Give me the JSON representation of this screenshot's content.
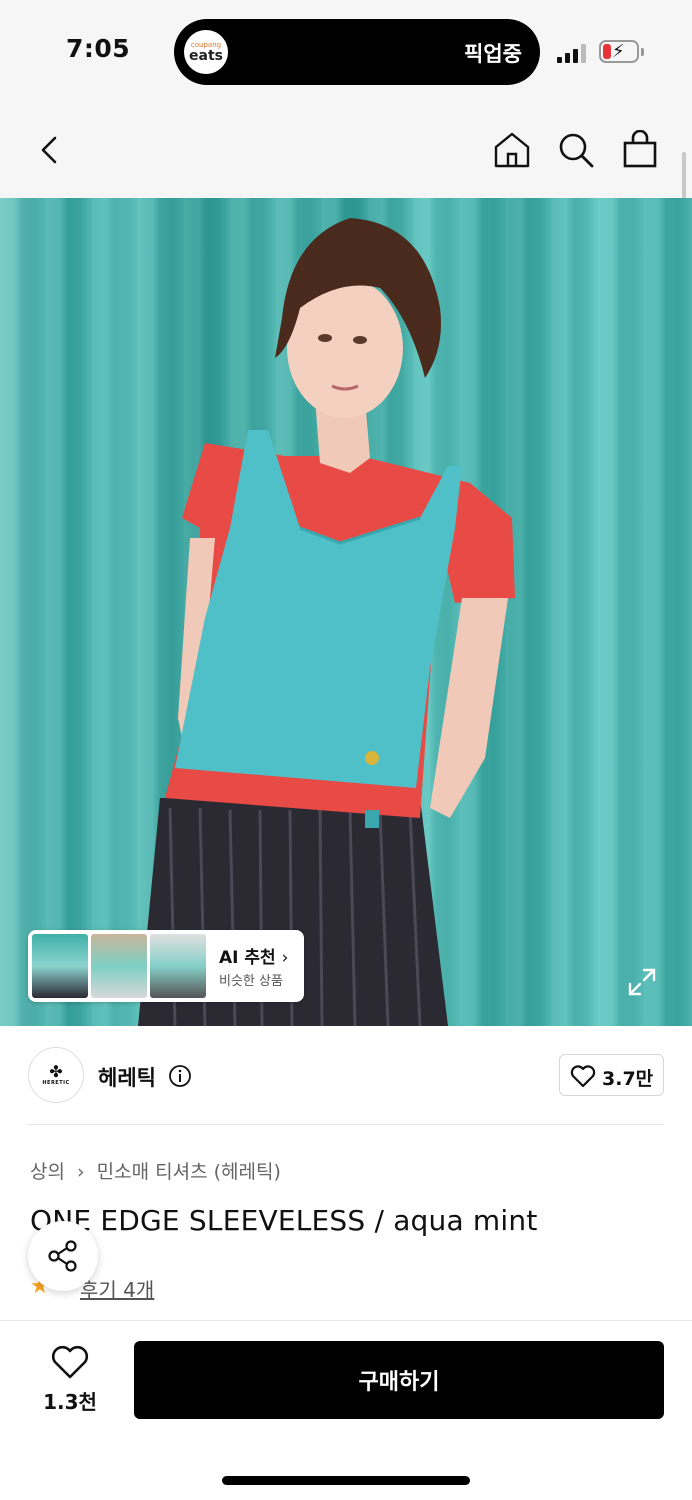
{
  "status_bar": {
    "time": "7:05",
    "live_activity_app": {
      "brand_top": "coupang",
      "brand_bottom": "eats"
    },
    "live_activity_text": "픽업중"
  },
  "nav": {
    "icons": [
      "back-icon",
      "home-icon",
      "search-icon",
      "shopping-bag-icon"
    ]
  },
  "ai_recommend": {
    "title": "AI 추천",
    "subtitle": "비슷한 상품"
  },
  "brand": {
    "logo_text": "HERETIC",
    "name": "헤레틱",
    "like_count": "3.7만"
  },
  "product": {
    "breadcrumb": [
      "상의",
      "민소매 티셔츠 (헤레틱)"
    ],
    "title": "ONE EDGE SLEEVELESS / aqua mint",
    "review_link": "후기 4개"
  },
  "bottom": {
    "wish_count": "1.3천",
    "buy_label": "구매하기"
  },
  "colors": {
    "accent_black": "#000000",
    "star": "#f5a623",
    "battery_low": "#e8333b",
    "curtain_teal": "#3aa9a4"
  }
}
